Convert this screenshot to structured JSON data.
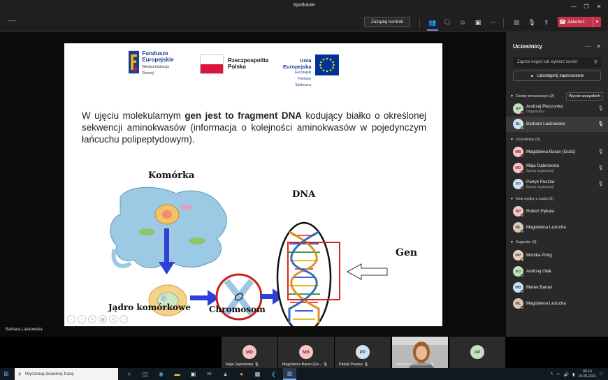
{
  "window": {
    "title": "Spotkanie",
    "timer": "--:--"
  },
  "toolbar": {
    "control_label": "Zażądaj kontroli",
    "end_label": "Zakończ"
  },
  "slide": {
    "logos": {
      "fe_line1": "Fundusze",
      "fe_line2": "Europejskie",
      "fe_sub": "Wiedza Edukacja Rozwój",
      "rp_line1": "Rzeczpospolita",
      "rp_line2": "Polska",
      "ue_line1": "Unia Europejska",
      "ue_sub": "Europejski Fundusz Społeczny"
    },
    "text_part1": "W ujęciu molekularnym ",
    "text_bold": "gen jest to fragment DNA",
    "text_part2": " kodujący białko o określonej sekwencji aminokwasów (informacja o kolejności aminokwasów w pojedynczym łańcuchu polipeptydowym).",
    "diagram": {
      "cell": "Komórka",
      "nucleus": "Jądro komórkowe",
      "chromosome": "Chromosom",
      "dna": "DNA",
      "gene": "Gen"
    }
  },
  "presenter_name": "Barbara Laskowska",
  "panel": {
    "title": "Uczestnicy",
    "search_placeholder": "Zaproś kogoś lub wybierz numer",
    "share_label": "Udostępnij zaproszenie",
    "mute_all_label": "Wycisz wszystkich",
    "sections": [
      {
        "title": "Osoby prowadzące (2)",
        "people": [
          {
            "initials": "AP",
            "name": "Andrzej Pieczonka",
            "sub": "Organizator",
            "color": "#c7e0c3",
            "text_color": "#2d6a2d",
            "muted": true
          },
          {
            "initials": "BL",
            "name": "Barbara Laskowska",
            "sub": "",
            "color": "#cfe3f0",
            "text_color": "#2a5a7a",
            "muted": false
          }
        ]
      },
      {
        "title": "Uczestnicy (3)",
        "people": [
          {
            "initials": "MB",
            "name": "Magdalena Baran (Gość)",
            "sub": "",
            "color": "#f3c6c8",
            "text_color": "#8a2b33",
            "muted": true
          },
          {
            "initials": "MD",
            "name": "Maja Dąbrowska",
            "sub": "Spoza organizacji",
            "color": "#f3c6c8",
            "text_color": "#8a2b33",
            "muted": true
          },
          {
            "initials": "PP",
            "name": "Patryk Puszka",
            "sub": "Spoza organizacji",
            "color": "#cfe3f0",
            "text_color": "#2a5a7a",
            "muted": true
          }
        ]
      },
      {
        "title": "Inne osoby z czatu (2)",
        "people": [
          {
            "initials": "RP",
            "name": "Robert Pękala",
            "sub": "",
            "color": "#f3c6c8",
            "text_color": "#8a2b33",
            "muted": false
          },
          {
            "initials": "ML",
            "name": "Magdalena Leżucha",
            "sub": "",
            "color": "#d9c7b8",
            "text_color": "#5a3a22",
            "muted": false
          }
        ]
      },
      {
        "title": "Sugestie (4)",
        "people": [
          {
            "initials": "MP",
            "name": "Monika Piróg",
            "sub": "",
            "color": "#e8d3c0",
            "text_color": "#5a3a22",
            "muted": false
          },
          {
            "initials": "AO",
            "name": "Andrzej Olak",
            "sub": "",
            "color": "#c7e0c3",
            "text_color": "#2d6a2d",
            "muted": false
          },
          {
            "initials": "MB",
            "name": "Marek Banaś",
            "sub": "",
            "color": "#cfe3f0",
            "text_color": "#2a5a7a",
            "muted": false
          },
          {
            "initials": "ML",
            "name": "Magdalena Leżucha",
            "sub": "",
            "color": "#d9c7b8",
            "text_color": "#5a3a22",
            "muted": false
          }
        ]
      }
    ]
  },
  "strip": [
    {
      "initials": "MD",
      "name": "Maja Dąbrowska",
      "color": "#f3c6c8",
      "text_color": "#8a2b33"
    },
    {
      "initials": "MB",
      "name": "Magdalena Baran (Go...",
      "color": "#f3c6c8",
      "text_color": "#8a2b33"
    },
    {
      "initials": "PP",
      "name": "Patryk Puszka",
      "color": "#cfe3f0",
      "text_color": "#2a5a7a"
    },
    {
      "initials": "",
      "name": "Barbara Laskowska",
      "color": "#8a8a8a",
      "text_color": "#fff"
    },
    {
      "initials": "AP",
      "name": "",
      "color": "#c7e0c3",
      "text_color": "#2d6a2d"
    }
  ],
  "taskbar": {
    "search_placeholder": "Wyszukaj dowolną frazę",
    "time": "09:14",
    "date": "15.05.2021"
  }
}
